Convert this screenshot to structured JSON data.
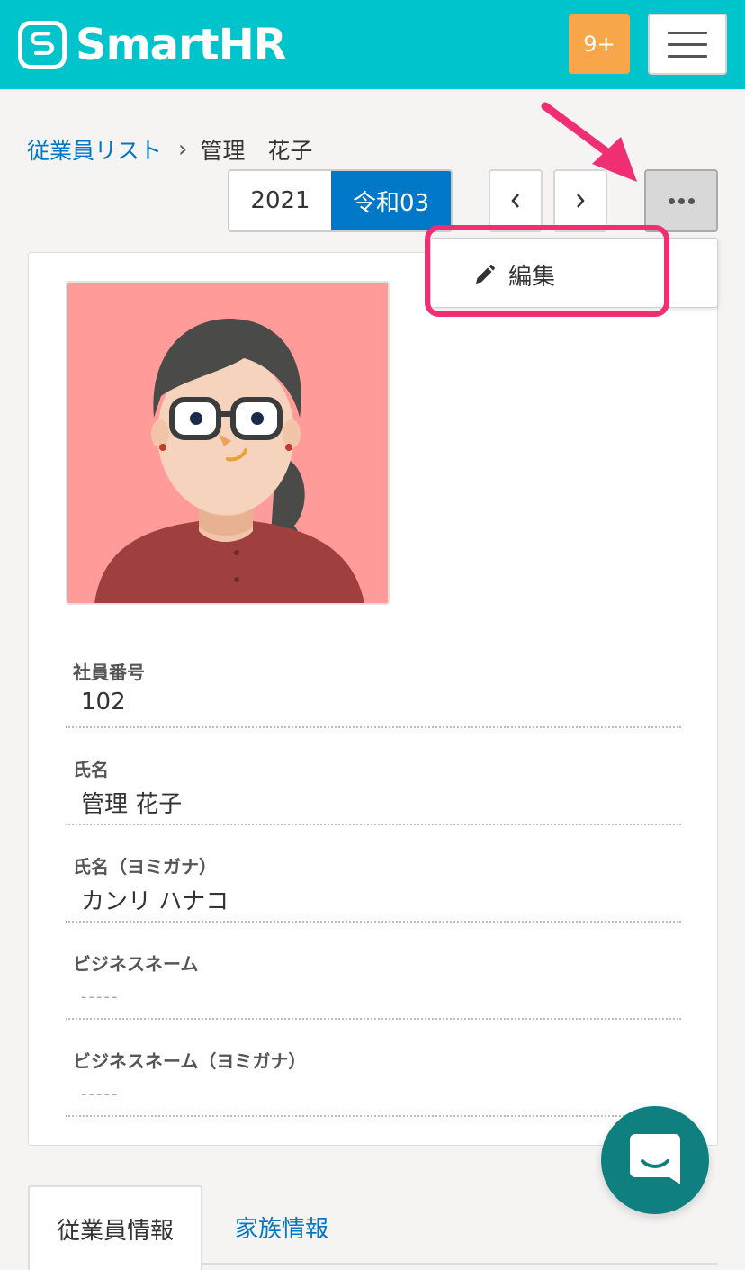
{
  "header": {
    "logo_text": "SmartHR",
    "notifications_badge": "9+",
    "colors": {
      "bar": "#00c4cc",
      "badge": "#f7a64a"
    }
  },
  "breadcrumb": {
    "parent": "従業員リスト",
    "current": "管理　花子"
  },
  "year_toggle": {
    "western": "2021",
    "japanese": "令和03",
    "selected": "japanese"
  },
  "nav": {
    "prev_icon": "chevron-left-icon",
    "next_icon": "chevron-right-icon",
    "more_icon": "more-horizontal-icon"
  },
  "dropdown": {
    "items": [
      {
        "icon": "pencil-icon",
        "label": "編集"
      }
    ]
  },
  "profile": {
    "fields": [
      {
        "label": "社員番号",
        "value": "102"
      },
      {
        "label": "氏名",
        "value": "管理 花子"
      },
      {
        "label": "氏名（ヨミガナ）",
        "value": "カンリ ハナコ"
      },
      {
        "label": "ビジネスネーム",
        "value": "-----"
      },
      {
        "label": "ビジネスネーム（ヨミガナ）",
        "value": "-----"
      }
    ]
  },
  "tabs": [
    {
      "label": "従業員情報",
      "active": true
    },
    {
      "label": "家族情報",
      "active": false
    }
  ],
  "chat": {
    "icon": "chat-icon"
  },
  "annotation": {
    "highlight_color": "#f02e73"
  }
}
